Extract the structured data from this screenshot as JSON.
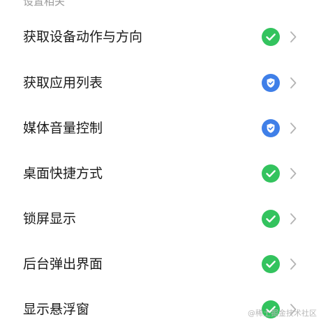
{
  "section": {
    "title": "设置相关"
  },
  "colors": {
    "allowed": "#33c35e",
    "prompt": "#3f7fe8",
    "chevron": "#b3b3b3"
  },
  "items": [
    {
      "label": "获取设备动作与方向",
      "status_icon": "check-circle-icon",
      "status_color": "#33c35e"
    },
    {
      "label": "获取应用列表",
      "status_icon": "shield-check-icon",
      "status_color": "#3f7fe8"
    },
    {
      "label": "媒体音量控制",
      "status_icon": "shield-check-icon",
      "status_color": "#3f7fe8"
    },
    {
      "label": "桌面快捷方式",
      "status_icon": "check-circle-icon",
      "status_color": "#33c35e"
    },
    {
      "label": "锁屏显示",
      "status_icon": "check-circle-icon",
      "status_color": "#33c35e"
    },
    {
      "label": "后台弹出界面",
      "status_icon": "check-circle-icon",
      "status_color": "#33c35e"
    },
    {
      "label": "显示悬浮窗",
      "status_icon": "check-circle-icon",
      "status_color": "#33c35e"
    }
  ],
  "watermark": "@稀土掘金技术社区"
}
